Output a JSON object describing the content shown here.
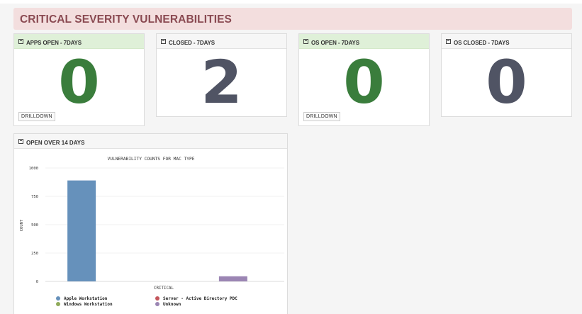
{
  "banner": {
    "title": "CRITICAL SEVERITY VULNERABILITIES"
  },
  "tiles": [
    {
      "title": "APPS OPEN - 7DAYS",
      "value": "0",
      "drilldown": "DRILLDOWN"
    },
    {
      "title": "CLOSED - 7DAYS",
      "value": "2"
    },
    {
      "title": "OS OPEN - 7DAYS",
      "value": "0",
      "drilldown": "DRILLDOWN"
    },
    {
      "title": "OS CLOSED - 7DAYS",
      "value": "0"
    }
  ],
  "panel": {
    "title": "OPEN OVER 14 DAYS"
  },
  "colors": {
    "apple": "#6691bb",
    "server": "#c4565c",
    "windows": "#8faa5a",
    "unknown": "#9b85b3",
    "green_header": "#dff0d8",
    "banner": "#f3dede"
  },
  "chart_data": {
    "type": "bar",
    "title": "VULNERABILITY COUNTS FOR MAC TYPE",
    "xlabel": "CRITICAL",
    "ylabel": "COUNT",
    "ylim": [
      0,
      1000
    ],
    "yticks": [
      "0",
      "250",
      "500",
      "750",
      "1000"
    ],
    "categories": [
      "CRITICAL"
    ],
    "series": [
      {
        "name": "Apple Workstation",
        "values": [
          890
        ]
      },
      {
        "name": "Windows Workstation",
        "values": [
          0
        ]
      },
      {
        "name": "Server - Active Directory PDC",
        "values": [
          0
        ]
      },
      {
        "name": "Unknown",
        "values": [
          45
        ]
      }
    ],
    "legend": "bottom"
  }
}
